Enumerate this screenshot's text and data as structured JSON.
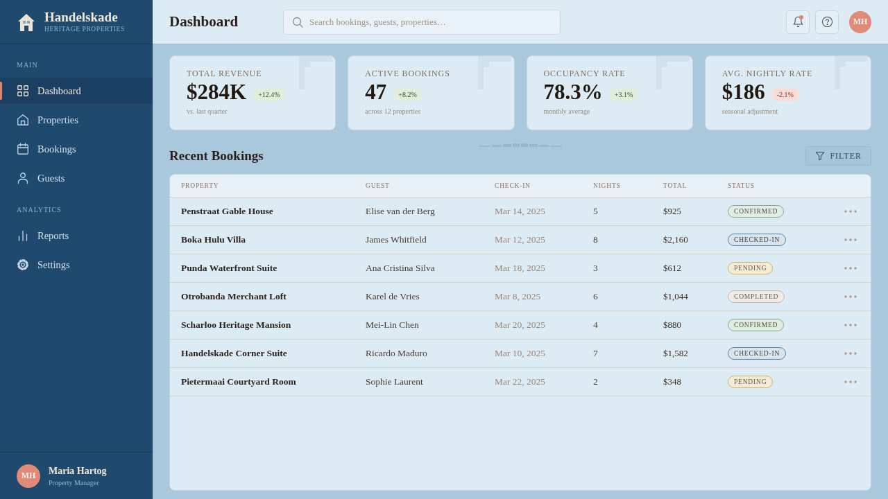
{
  "sidebar": {
    "brand": {
      "name": "Handelskade",
      "tagline": "HERITAGE PROPERTIES"
    },
    "sections": [
      {
        "heading": "MAIN",
        "items": [
          {
            "label": "Dashboard",
            "selected": true
          },
          {
            "label": "Properties",
            "selected": false
          },
          {
            "label": "Bookings",
            "selected": false
          },
          {
            "label": "Guests",
            "selected": false
          }
        ]
      },
      {
        "heading": "ANALYTICS",
        "items": [
          {
            "label": "Reports",
            "selected": false
          },
          {
            "label": "Settings",
            "selected": false
          }
        ]
      }
    ],
    "user": {
      "initials": "MH",
      "name": "Maria Hartog",
      "role": "Property Manager"
    }
  },
  "header": {
    "title": "Dashboard",
    "search": {
      "placeholder": "Search bookings, guests, properties…"
    },
    "notifications_unread": true,
    "avatar_initials": "MH"
  },
  "stats": [
    {
      "label": "TOTAL REVENUE",
      "value": "$284K",
      "change": "+12.4%",
      "positive": true,
      "note": "vs. last quarter"
    },
    {
      "label": "ACTIVE BOOKINGS",
      "value": "47",
      "change": "+8.2%",
      "positive": true,
      "note": "across 12 properties"
    },
    {
      "label": "OCCUPANCY RATE",
      "value": "78.3%",
      "change": "+3.1%",
      "positive": true,
      "note": "monthly average"
    },
    {
      "label": "AVG. NIGHTLY RATE",
      "value": "$186",
      "change": "-2.1%",
      "positive": false,
      "note": "seasonal adjustment"
    }
  ],
  "recent_bookings": {
    "title": "Recent Bookings",
    "filter_label": "FILTER",
    "columns": [
      "PROPERTY",
      "GUEST",
      "CHECK-IN",
      "NIGHTS",
      "TOTAL",
      "STATUS"
    ],
    "rows": [
      {
        "property": "Penstraat Gable House",
        "guest": "Elise van der Berg",
        "check_in": "Mar 14, 2025",
        "nights": "5",
        "total": "$925",
        "status": {
          "label": "CONFIRMED",
          "color": "#7fb08a"
        }
      },
      {
        "property": "Boka Hulu Villa",
        "guest": "James Whitfield",
        "check_in": "Mar 12, 2025",
        "nights": "8",
        "total": "$2,160",
        "status": {
          "label": "CHECKED-IN",
          "color": "#4a86b8"
        }
      },
      {
        "property": "Punda Waterfront Suite",
        "guest": "Ana Cristina Silva",
        "check_in": "Mar 18, 2025",
        "nights": "3",
        "total": "$612",
        "status": {
          "label": "PENDING",
          "color": "#d6b45c"
        }
      },
      {
        "property": "Otrobanda Merchant Loft",
        "guest": "Karel de Vries",
        "check_in": "Mar 8, 2025",
        "nights": "6",
        "total": "$1,044",
        "status": {
          "label": "COMPLETED",
          "color": "#c4b8ac"
        }
      },
      {
        "property": "Scharloo Heritage Mansion",
        "guest": "Mei-Lin Chen",
        "check_in": "Mar 20, 2025",
        "nights": "4",
        "total": "$880",
        "status": {
          "label": "CONFIRMED",
          "color": "#7fb08a"
        }
      },
      {
        "property": "Handelskade Corner Suite",
        "guest": "Ricardo Maduro",
        "check_in": "Mar 10, 2025",
        "nights": "7",
        "total": "$1,582",
        "status": {
          "label": "CHECKED-IN",
          "color": "#4a86b8"
        }
      },
      {
        "property": "Pietermaai Courtyard Room",
        "guest": "Sophie Laurent",
        "check_in": "Mar 22, 2025",
        "nights": "2",
        "total": "$348",
        "status": {
          "label": "PENDING",
          "color": "#d6b45c"
        }
      }
    ]
  }
}
